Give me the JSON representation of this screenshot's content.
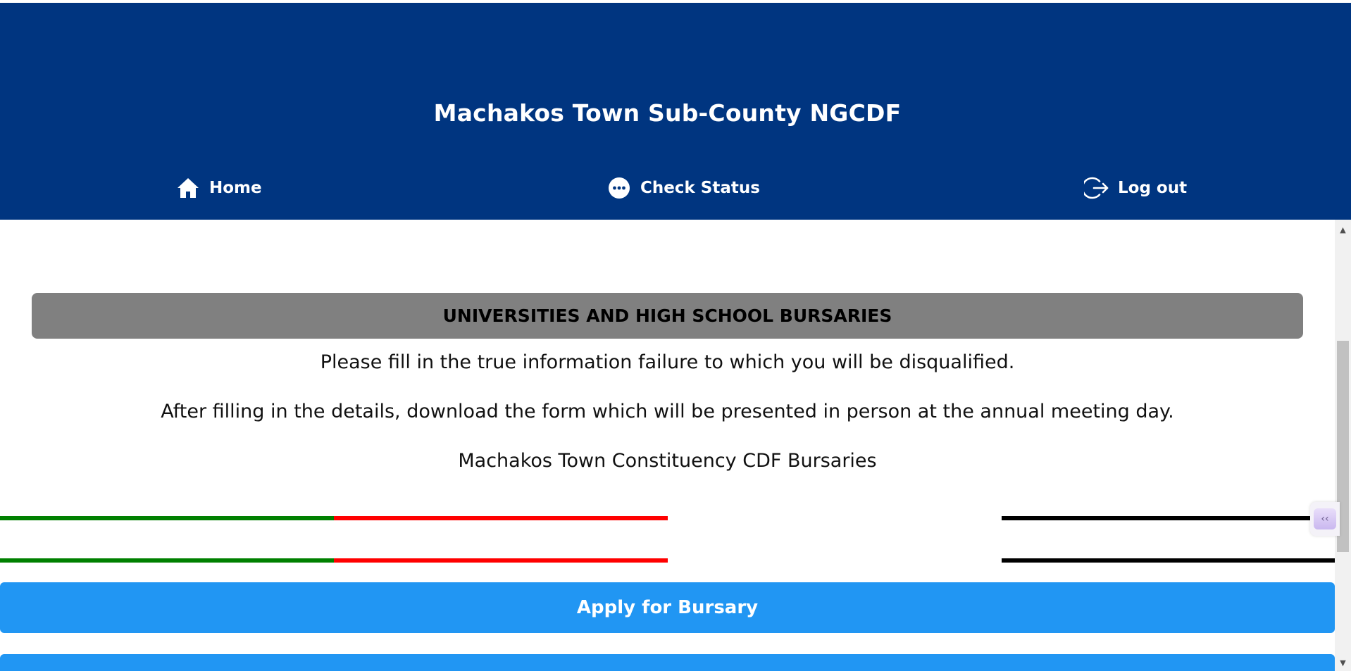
{
  "header": {
    "title": "Machakos Town Sub-County NGCDF",
    "background": "#003580"
  },
  "nav": {
    "items": [
      {
        "label": "Home",
        "icon": "home-icon"
      },
      {
        "label": "Check Status",
        "icon": "chat-bubble-icon"
      },
      {
        "label": "Log out",
        "icon": "logout-icon"
      }
    ]
  },
  "main": {
    "banner": "UNIVERSITIES AND HIGH SCHOOL BURSARIES",
    "paragraphs": [
      "Please fill in the true information failure to which you will be disqualified.",
      "After filling in the details, download the form which will be presented in person at the annual meeting day.",
      "Machakos Town Constituency CDF Bursaries"
    ],
    "flag_colors": [
      "#008000",
      "#ff0000",
      "#ffffff",
      "#000000"
    ],
    "apply_button": "Apply for Bursary"
  },
  "colors": {
    "button": "#2196f3",
    "banner": "#808080"
  }
}
